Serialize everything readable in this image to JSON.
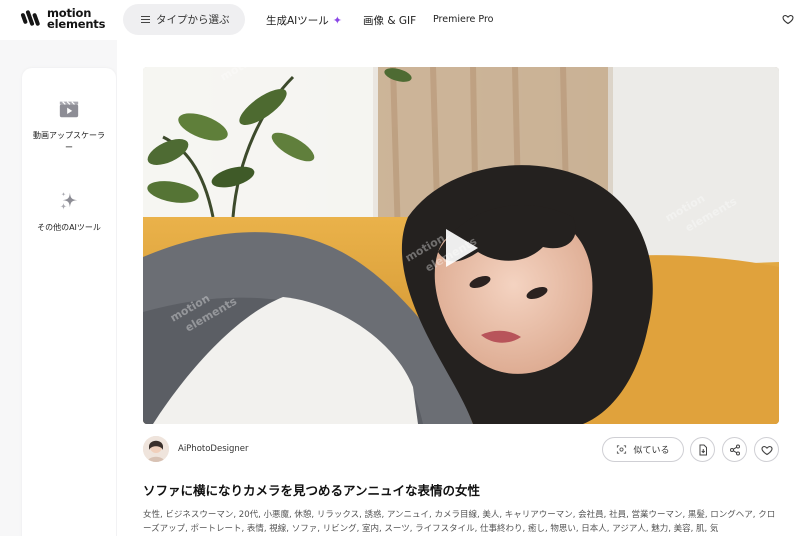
{
  "header": {
    "logo_line1": "motion",
    "logo_line2": "elements",
    "search_label": "タイプから選ぶ",
    "nav_ai": "生成AIツール",
    "nav_images": "画像 & GIF",
    "nav_premiere": "Premiere Pro"
  },
  "sidebar": {
    "items": [
      {
        "label": "動画アップスケーラー",
        "icon": "film-play-icon"
      },
      {
        "label": "その他のAIツール",
        "icon": "sparkles-icon"
      }
    ]
  },
  "media": {
    "watermark": "motion elements"
  },
  "author": {
    "name": "AiPhotoDesigner"
  },
  "actions": {
    "similar_label": "似ている"
  },
  "item": {
    "title": "ソファに横になりカメラを見つめるアンニュイな表情の女性",
    "tags": "女性, ビジネスウーマン, 20代, 小悪魔, 休憩, リラックス, 誘惑, アンニュイ, カメラ目線, 美人, キャリアウーマン, 会社員, 社員, 営業ウーマン, 黒髪, ロングヘア, クローズアップ, ポートレート, 表情, 視線, ソファ, リビング, 室内, スーツ, ライフスタイル, 仕事終わり, 癒し, 物思い, 日本人, アジア人, 魅力, 美容, 肌, 気"
  },
  "colors": {
    "accent_purple": "#8a46e6",
    "sofa_yellow": "#e3a63a"
  }
}
